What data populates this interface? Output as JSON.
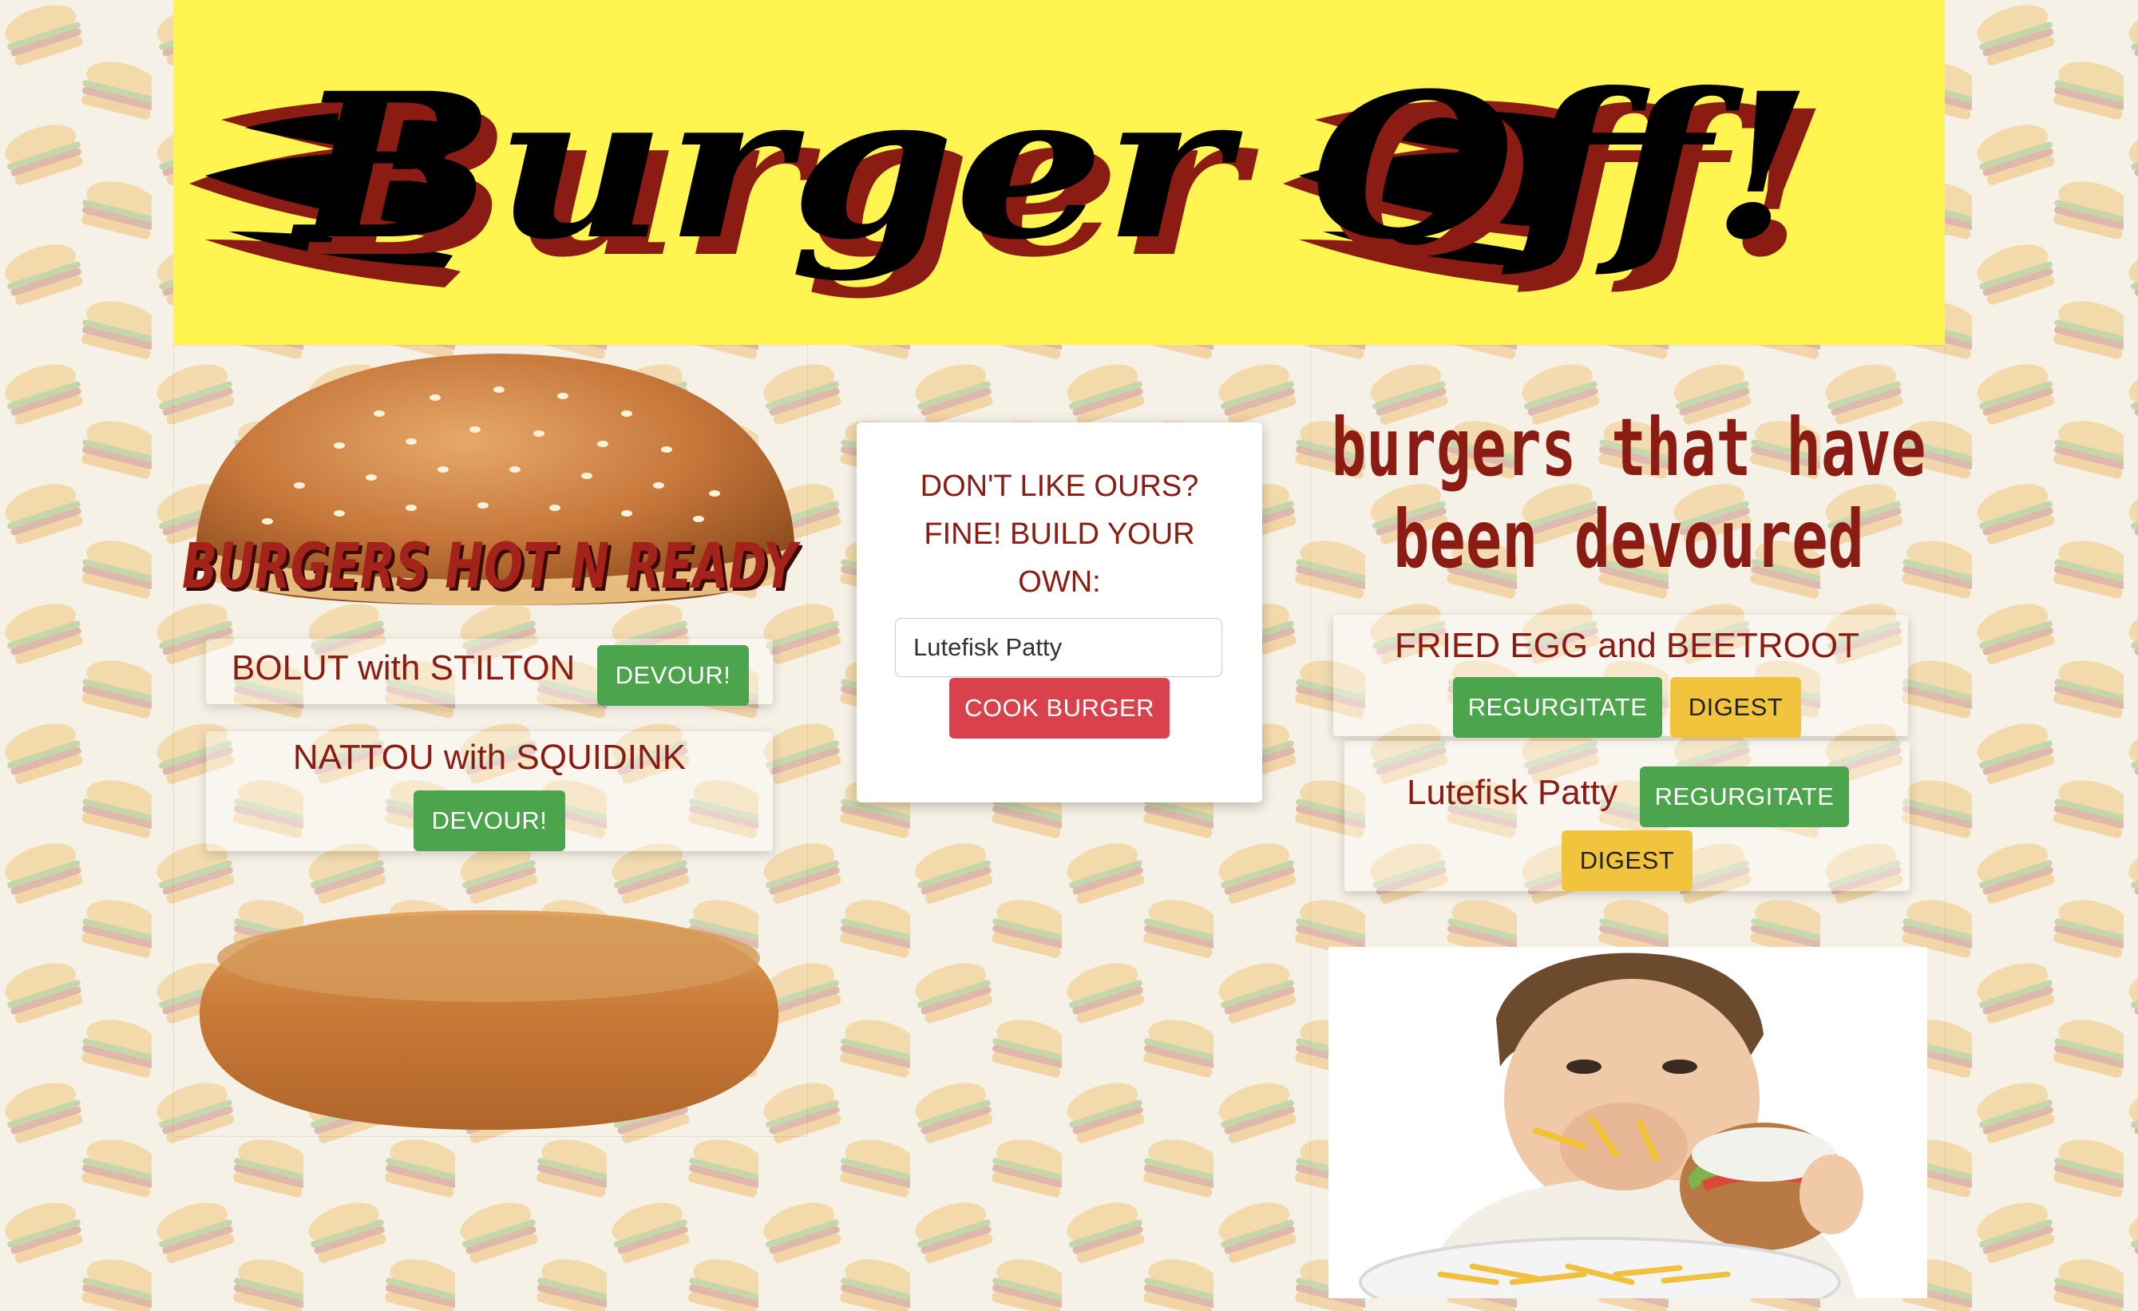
{
  "app": {
    "title": "Burger Off!"
  },
  "ready_panel": {
    "heading": "BURGERS HOT N READY",
    "burgers": [
      {
        "name": "BOLUT with STILTON",
        "button": "DEVOUR!"
      },
      {
        "name": "NATTOU with SQUIDINK",
        "button": "DEVOUR!"
      }
    ]
  },
  "build_panel": {
    "prompt": "DON'T LIKE OURS? FINE! BUILD YOUR OWN:",
    "input_value": "Lutefisk Patty",
    "submit_label": "COOK BURGER"
  },
  "devoured_panel": {
    "heading_line1": "burgers that have",
    "heading_line2": "been devoured",
    "burgers": [
      {
        "name": "FRIED EGG and BEETROOT",
        "regurgitate": "REGURGITATE",
        "digest": "DIGEST"
      },
      {
        "name": "Lutefisk Patty",
        "regurgitate": "REGURGITATE",
        "digest": "DIGEST"
      }
    ]
  },
  "colors": {
    "header_bg": "#fff450",
    "brand_red": "#8a1c14",
    "devour_green": "#4ca54c",
    "digest_yellow": "#f2c43d",
    "cook_red": "#d9424d"
  },
  "icons": {
    "flame": "flame-icon",
    "bun_top": "bun-top-icon",
    "bun_bottom": "bun-bottom-icon",
    "kid_photo": "kid-eating-burger-image"
  }
}
